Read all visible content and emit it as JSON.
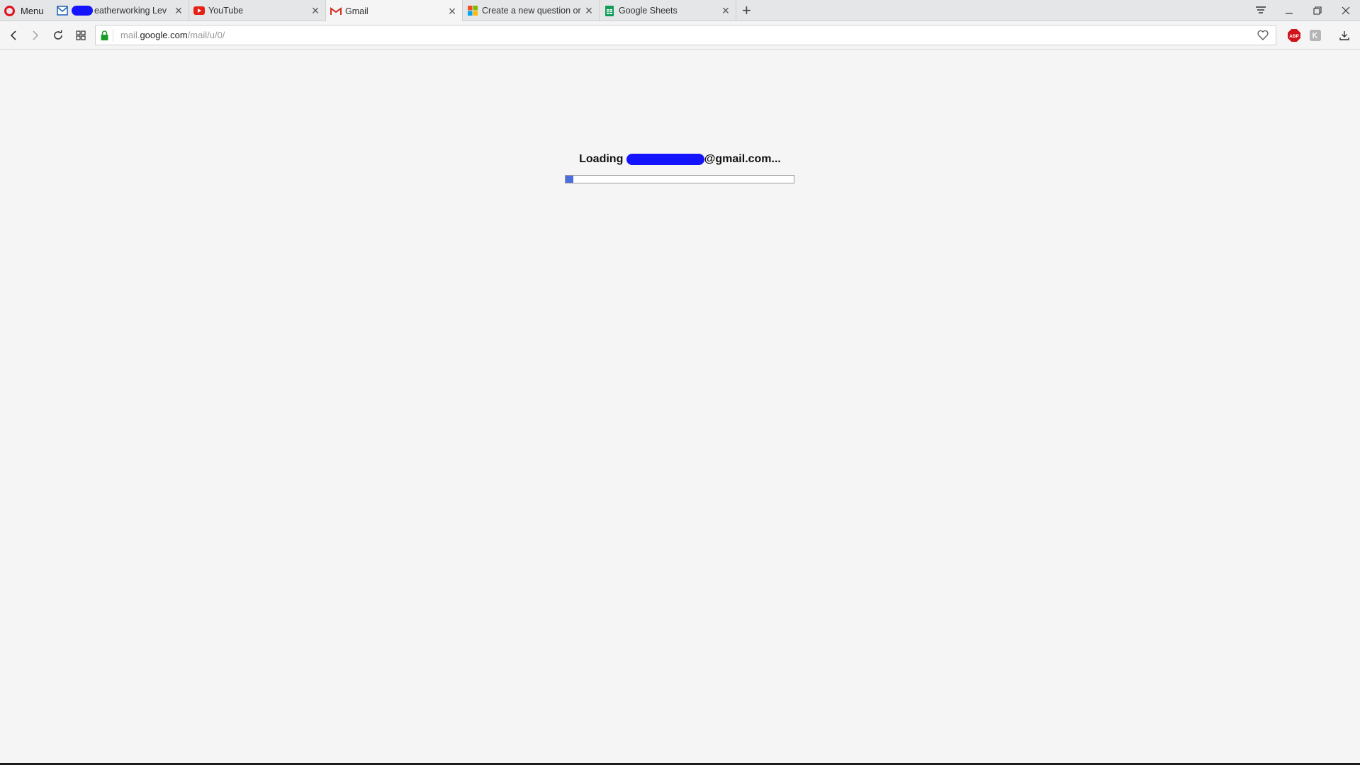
{
  "browser": {
    "menu_label": "Menu",
    "tabs": [
      {
        "title": "eatherworking Lev",
        "favicon": "mail-icon",
        "active": false
      },
      {
        "title": "YouTube",
        "favicon": "youtube-icon",
        "active": false
      },
      {
        "title": "Gmail",
        "favicon": "gmail-icon",
        "active": true
      },
      {
        "title": "Create a new question or",
        "favicon": "microsoft-icon",
        "active": false
      },
      {
        "title": "Google Sheets",
        "favicon": "sheets-icon",
        "active": false
      }
    ],
    "new_tab_label": "+"
  },
  "address_bar": {
    "host": "mail.google.com",
    "host_prefix": "mail.",
    "host_main": "google.com",
    "path": "/mail/u/0/",
    "secure": true
  },
  "page": {
    "loading_prefix": "Loading",
    "email_suffix": "@gmail.com...",
    "progress": 0.035
  },
  "colors": {
    "accent_opera": "#e0121b",
    "progress_fill": "#4a6ee0",
    "redaction": "#1414ff",
    "background": "#f5f5f5"
  }
}
